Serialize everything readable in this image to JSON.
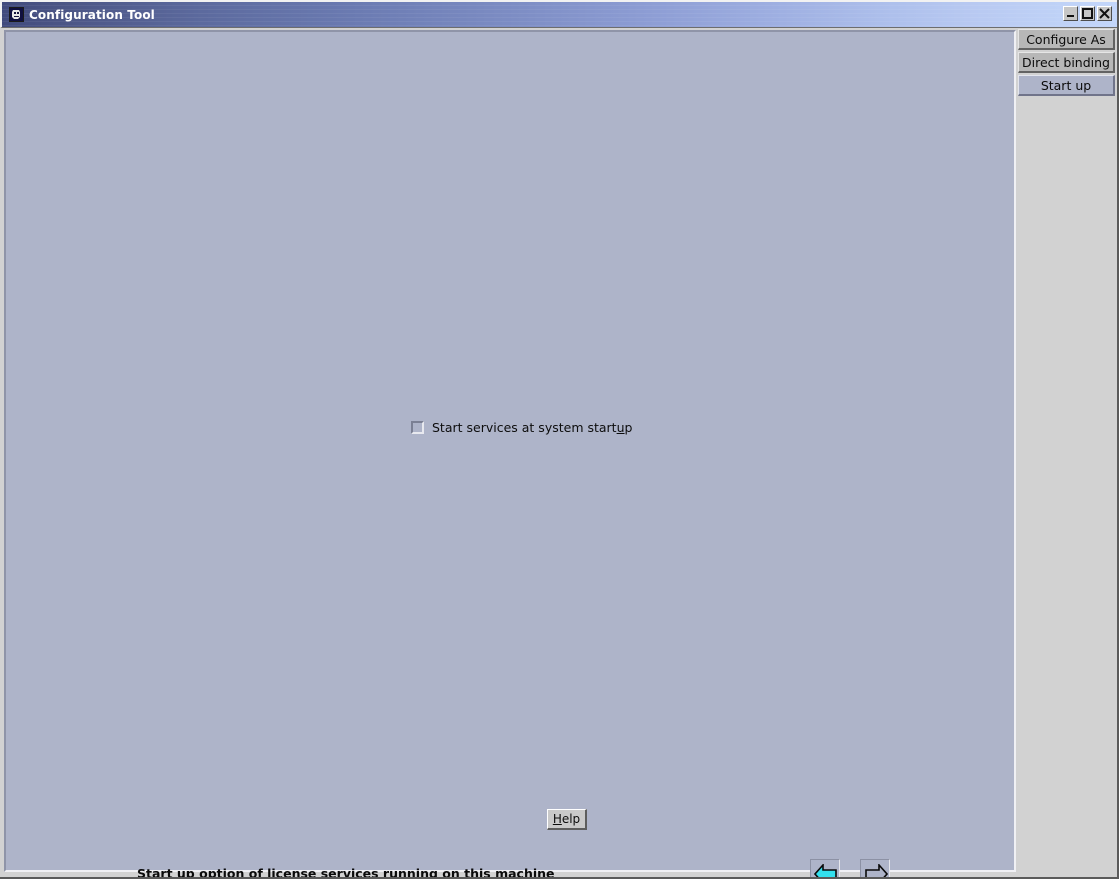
{
  "window": {
    "title": "Configuration Tool",
    "icon": "app-icon",
    "controls": {
      "minimize_label": "_",
      "maximize_label": "□",
      "close_label": "✕"
    }
  },
  "sidebar": {
    "tabs": [
      {
        "label": "Configure As",
        "selected": false
      },
      {
        "label": "Direct binding",
        "selected": false
      },
      {
        "label": "Start up",
        "selected": true
      }
    ]
  },
  "main": {
    "checkbox": {
      "label_before": "Start services at system start",
      "label_mnemonic": "u",
      "label_after": "p",
      "checked": false
    },
    "help_button": {
      "mnemonic": "H",
      "rest": "elp"
    },
    "status_text": "Start up option of license services running on this machine",
    "nav": {
      "back_label": "back-arrow",
      "forward_label": "forward-arrow",
      "back_enabled": true,
      "forward_enabled": false
    }
  },
  "colors": {
    "client_background": "#aeb4c9",
    "sidebar_background": "#d2d2d2",
    "title_gradient_start": "#414b7d",
    "title_gradient_end": "#c3d6fa",
    "back_arrow_fill": "#33e0ee",
    "forward_arrow_fill": "#aeb4c9"
  }
}
